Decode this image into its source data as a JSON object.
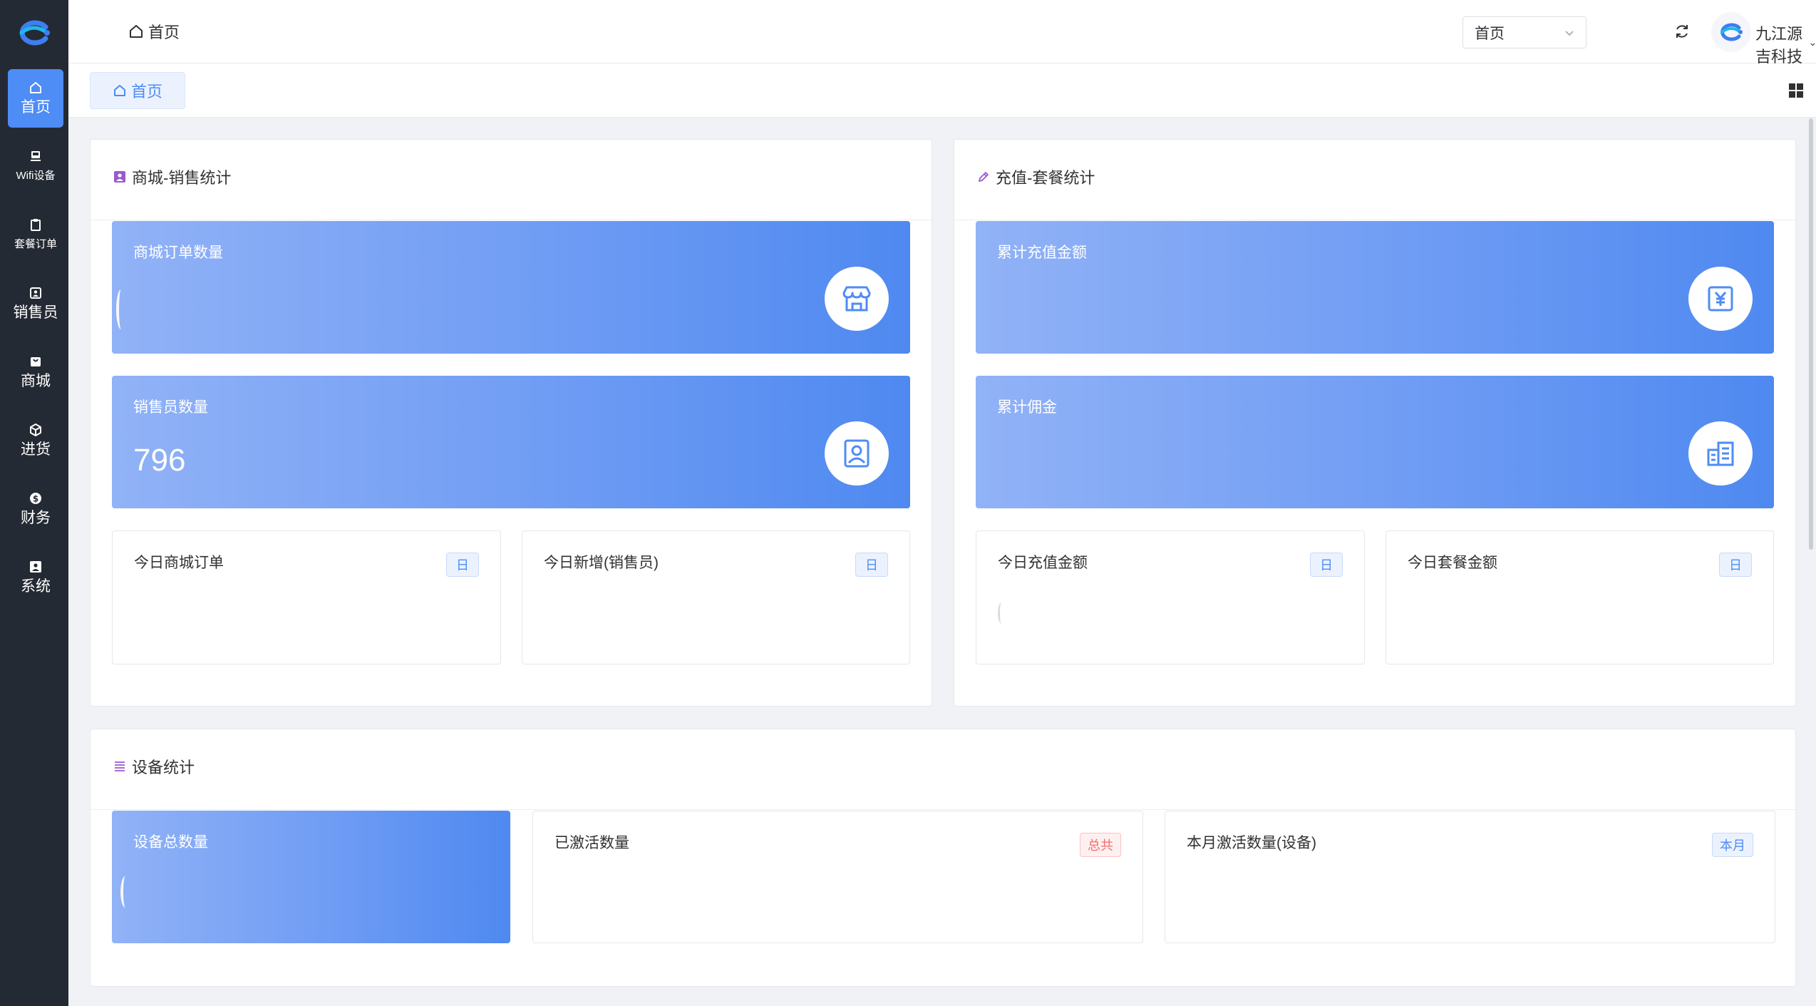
{
  "sidebar": {
    "items": [
      {
        "label": "首页",
        "icon": "home-icon",
        "active": true
      },
      {
        "label": "Wifi设备",
        "icon": "monitor-icon"
      },
      {
        "label": "套餐订单",
        "icon": "clipboard-icon"
      },
      {
        "label": "销售员",
        "icon": "id-card-icon"
      },
      {
        "label": "商城",
        "icon": "shopping-bag-icon"
      },
      {
        "label": "进货",
        "icon": "box-icon"
      },
      {
        "label": "财务",
        "icon": "dollar-circle-icon"
      },
      {
        "label": "系统",
        "icon": "user-square-icon"
      }
    ]
  },
  "header": {
    "breadcrumb": "首页",
    "select_value": "首页",
    "user_name": "九江源吉科技"
  },
  "tags": {
    "active_tag": "首页"
  },
  "panels": {
    "mall": {
      "title": "商城-销售统计",
      "cards": [
        {
          "label": "商城订单数量",
          "value": ""
        },
        {
          "label": "销售员数量",
          "value": "796"
        }
      ],
      "mini": [
        {
          "label": "今日商城订单",
          "badge": "日"
        },
        {
          "label": "今日新增(销售员)",
          "badge": "日"
        }
      ]
    },
    "recharge": {
      "title": "充值-套餐统计",
      "cards": [
        {
          "label": "累计充值金额",
          "value": ""
        },
        {
          "label": "累计佣金",
          "value": ""
        }
      ],
      "mini": [
        {
          "label": "今日充值金额",
          "badge": "日"
        },
        {
          "label": "今日套餐金额",
          "badge": "日"
        }
      ]
    },
    "device": {
      "title": "设备统计",
      "card": {
        "label": "设备总数量",
        "value": ""
      },
      "mini": [
        {
          "label": "已激活数量",
          "badge": "总共"
        },
        {
          "label": "本月激活数量(设备)",
          "badge": "本月"
        }
      ]
    }
  },
  "colors": {
    "sidebar_bg": "#242a33",
    "accent": "#4e8cf6",
    "card_gradient_start": "#91b2f6",
    "card_gradient_end": "#4f89f0",
    "badge_red": "#f56c6c"
  }
}
